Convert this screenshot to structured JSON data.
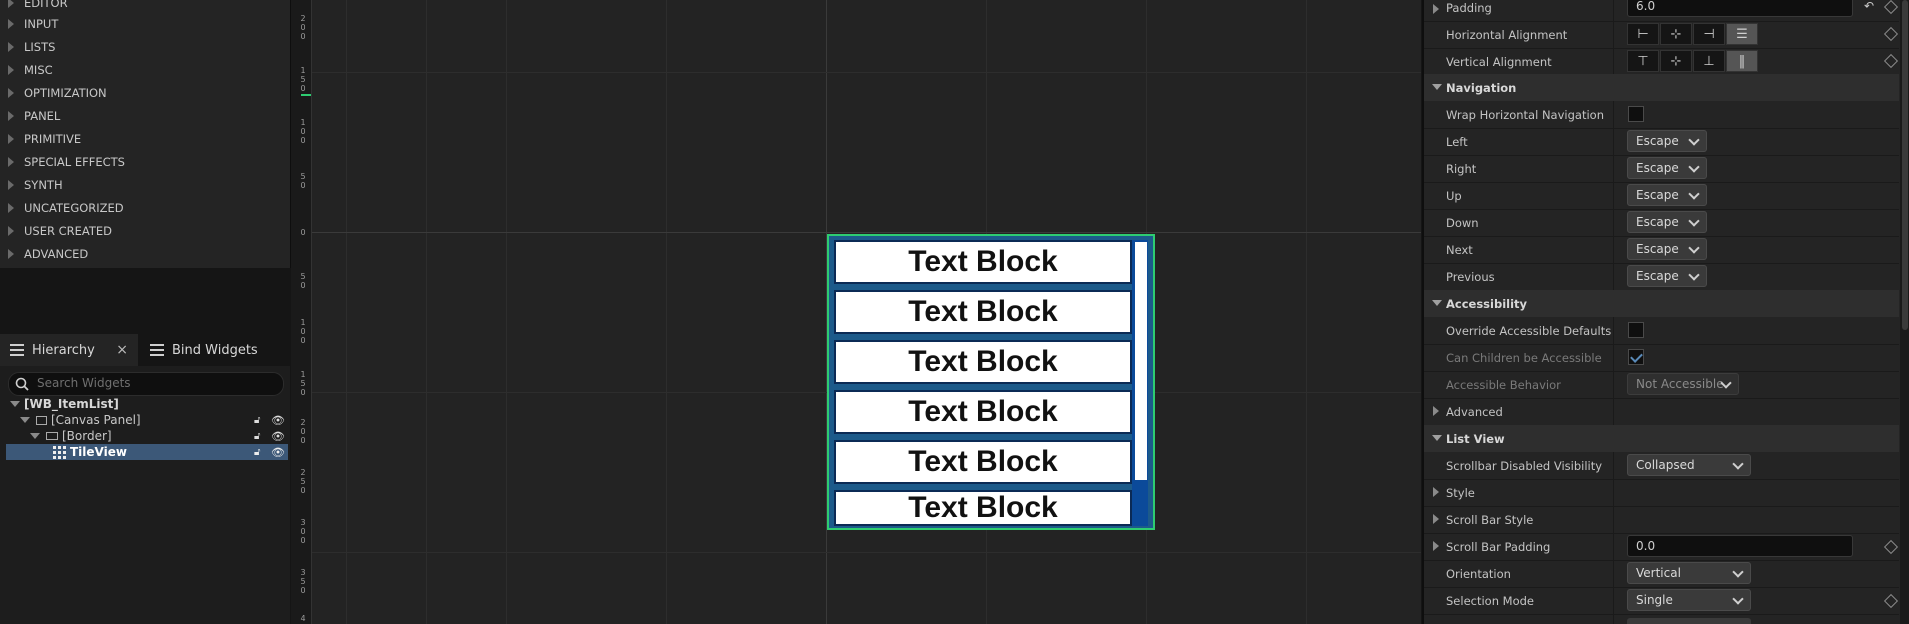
{
  "palette": {
    "categories": [
      "EDITOR",
      "INPUT",
      "LISTS",
      "MISC",
      "OPTIMIZATION",
      "PANEL",
      "PRIMITIVE",
      "SPECIAL EFFECTS",
      "SYNTH",
      "UNCATEGORIZED",
      "USER CREATED",
      "ADVANCED"
    ]
  },
  "hierarchy": {
    "tab_label": "Hierarchy",
    "tab_close": "×",
    "bind_tab_label": "Bind Widgets",
    "search_placeholder": "Search Widgets",
    "items": [
      "[WB_ItemList]",
      "[Canvas Panel]",
      "[Border]",
      "TileView"
    ]
  },
  "ruler": {
    "numbers": [
      "2\n0\n0",
      "1\n5\n0",
      "1\n0\n0",
      "5\n0",
      "0",
      "5\n0",
      "1\n0\n0",
      "1\n5\n0",
      "2\n0\n0",
      "2\n5\n0",
      "3\n0\n0",
      "3\n5\n0",
      "4"
    ]
  },
  "viewport": {
    "text_blocks": [
      "Text Block",
      "Text Block",
      "Text Block",
      "Text Block",
      "Text Block",
      "Text Block"
    ]
  },
  "details": {
    "padding_label": "Padding",
    "padding_value": "6.0",
    "h_align_label": "Horizontal Alignment",
    "v_align_label": "Vertical Alignment",
    "h_align_icons": [
      "⊢",
      "⊹",
      "⊣",
      "☰"
    ],
    "v_align_icons": [
      "⊤",
      "⊹",
      "⊥",
      "‖"
    ],
    "navigation_header": "Navigation",
    "wrap_h_nav_label": "Wrap Horizontal Navigation",
    "nav_rules": [
      {
        "label": "Left",
        "value": "Escape"
      },
      {
        "label": "Right",
        "value": "Escape"
      },
      {
        "label": "Up",
        "value": "Escape"
      },
      {
        "label": "Down",
        "value": "Escape"
      },
      {
        "label": "Next",
        "value": "Escape"
      },
      {
        "label": "Previous",
        "value": "Escape"
      }
    ],
    "accessibility_header": "Accessibility",
    "override_defaults_label": "Override Accessible Defaults",
    "children_accessible_label": "Can Children be Accessible",
    "accessible_behavior_label": "Accessible Behavior",
    "accessible_behavior_value": "Not Accessible",
    "advanced_label": "Advanced",
    "list_view_header": "List View",
    "scrollbar_vis_label": "Scrollbar Disabled Visibility",
    "scrollbar_vis_value": "Collapsed",
    "style_label": "Style",
    "scroll_bar_style_label": "Scroll Bar Style",
    "scroll_bar_padding_label": "Scroll Bar Padding",
    "scroll_bar_padding_value": "0.0",
    "orientation_label": "Orientation",
    "orientation_value": "Vertical",
    "selection_mode_label": "Selection Mode",
    "selection_mode_value": "Single"
  }
}
